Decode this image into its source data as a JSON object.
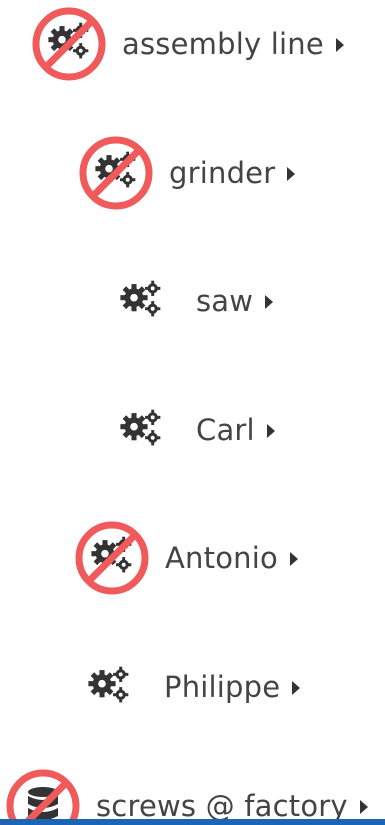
{
  "tree": {
    "nodes": [
      {
        "label": "assembly line",
        "icon": "gears-icon",
        "disabled": true
      },
      {
        "label": "grinder",
        "icon": "gears-icon",
        "disabled": true
      },
      {
        "label": "saw",
        "icon": "gears-icon",
        "disabled": false
      },
      {
        "label": "Carl",
        "icon": "gears-icon",
        "disabled": false
      },
      {
        "label": "Antonio",
        "icon": "gears-icon",
        "disabled": true
      },
      {
        "label": "Philippe",
        "icon": "gears-icon",
        "disabled": false
      },
      {
        "label": "screws @ factory",
        "icon": "database-icon",
        "disabled": true
      }
    ]
  },
  "colors": {
    "prohibit": "#f05a5a",
    "icon": "#333333",
    "text": "#444444",
    "bottom_bar": "#1a66b3"
  }
}
